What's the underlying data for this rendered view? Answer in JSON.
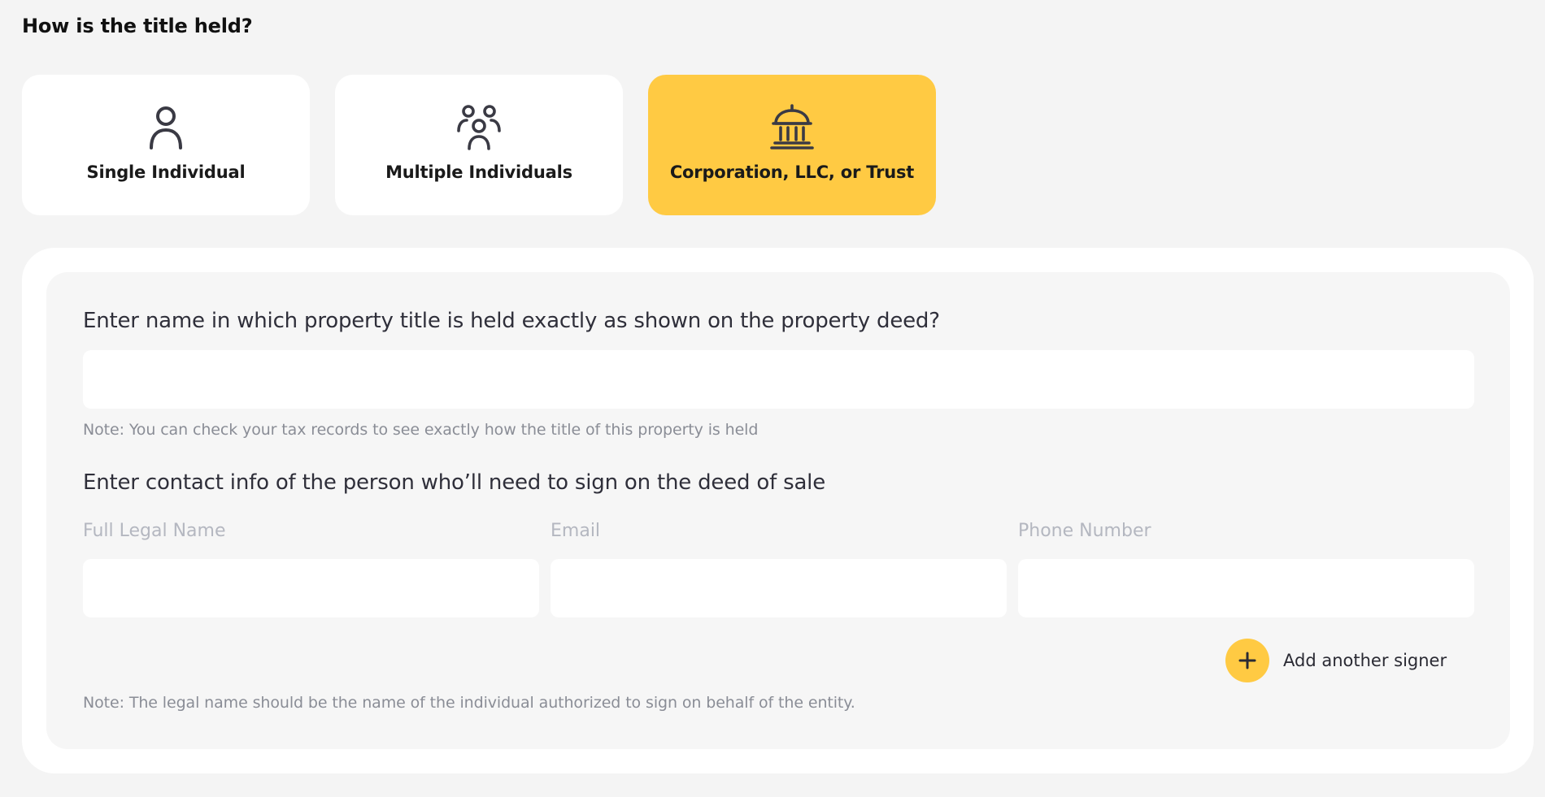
{
  "question": {
    "heading": "How is the title held?"
  },
  "options": [
    {
      "label": "Single Individual",
      "icon": "person-icon",
      "selected": false
    },
    {
      "label": "Multiple Individuals",
      "icon": "people-group-icon",
      "selected": false
    },
    {
      "label": "Corporation, LLC, or Trust",
      "icon": "bank-building-icon",
      "selected": true
    }
  ],
  "title_section": {
    "question": "Enter name in which property title is held exactly as shown on the property deed?",
    "input_value": "",
    "note": "Note: You can check your tax records to see exactly how the title of this property is held"
  },
  "contact_section": {
    "question": "Enter contact info of the person who’ll need to sign on the deed of sale",
    "fields": {
      "name_label": "Full Legal Name",
      "email_label": "Email",
      "phone_label": "Phone Number"
    },
    "add_signer_label": "Add another signer",
    "add_icon": "plus-icon",
    "note": "Note: The legal name should be the name of the individual authorized to sign on behalf of the entity."
  },
  "colors": {
    "accent": "#ffca43",
    "page_background": "#f4f4f4",
    "panel_inner": "#f6f6f6",
    "icon_stroke": "#3a3a44",
    "muted_text": "#8a8d96",
    "placeholder_label": "#b4b7c0"
  }
}
